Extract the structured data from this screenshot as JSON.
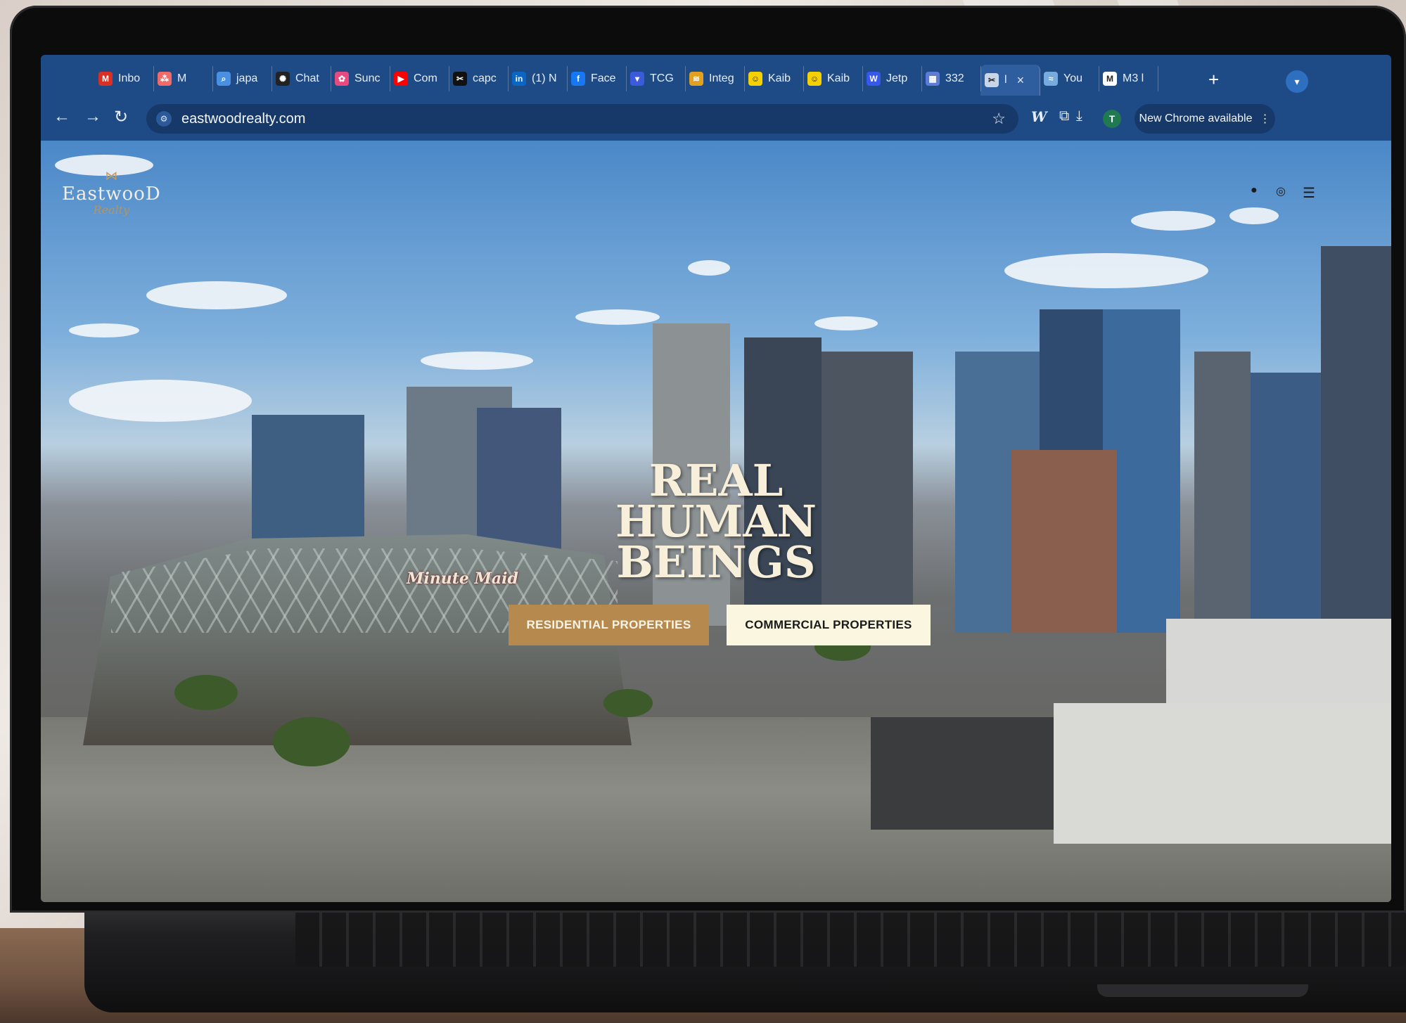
{
  "browser": {
    "tabs": [
      {
        "label": "Inbo",
        "icon": "gmail-icon",
        "color": "#d93025"
      },
      {
        "label": "M",
        "icon": "asana-icon",
        "color": "#f06a6a"
      },
      {
        "label": "japa",
        "icon": "search-icon",
        "color": "#4a90e2"
      },
      {
        "label": "Chat",
        "icon": "openai-icon",
        "color": "#222222"
      },
      {
        "label": "Sunc",
        "icon": "sunc-icon",
        "color": "#e84a7f"
      },
      {
        "label": "Com",
        "icon": "youtube-icon",
        "color": "#ff0000"
      },
      {
        "label": "capc",
        "icon": "capcut-icon",
        "color": "#111111"
      },
      {
        "label": "(1) N",
        "icon": "linkedin-icon",
        "color": "#0a66c2"
      },
      {
        "label": "Face",
        "icon": "facebook-icon",
        "color": "#1877f2"
      },
      {
        "label": "TCG",
        "icon": "tcg-icon",
        "color": "#3b5bdb"
      },
      {
        "label": "Integ",
        "icon": "integ-icon",
        "color": "#e0a020"
      },
      {
        "label": "Kaib",
        "icon": "kaib-icon",
        "color": "#f5d000"
      },
      {
        "label": "Kaib",
        "icon": "kaib-icon",
        "color": "#f5d000"
      },
      {
        "label": "Jetp",
        "icon": "wordpress-icon",
        "color": "#3858e9"
      },
      {
        "label": "332",
        "icon": "calendar-icon",
        "color": "#5b7bd5"
      },
      {
        "label": "l",
        "icon": "scissors-icon",
        "color": "#c9d6ea",
        "active": true
      },
      {
        "label": "You",
        "icon": "you-icon",
        "color": "#7ad"
      },
      {
        "label": "M3 l",
        "icon": "m-icon",
        "color": "#ffffff"
      }
    ],
    "new_tab": "+",
    "url": "eastwoodrealty.com",
    "profile_initial": "T",
    "update_label": "New Chrome available"
  },
  "site": {
    "logo_name": "EastwooD",
    "logo_sub": "Realty",
    "headline": [
      "REAL",
      "HUMAN",
      "BEINGS"
    ],
    "stadium_sign": "Minute Maid",
    "buttons": {
      "residential": "RESIDENTIAL PROPERTIES",
      "commercial": "COMMERCIAL PROPERTIES"
    }
  },
  "colors": {
    "chrome_bg": "#1e4a86",
    "accent_gold": "#b68a4e",
    "cream": "#fbf6df"
  }
}
